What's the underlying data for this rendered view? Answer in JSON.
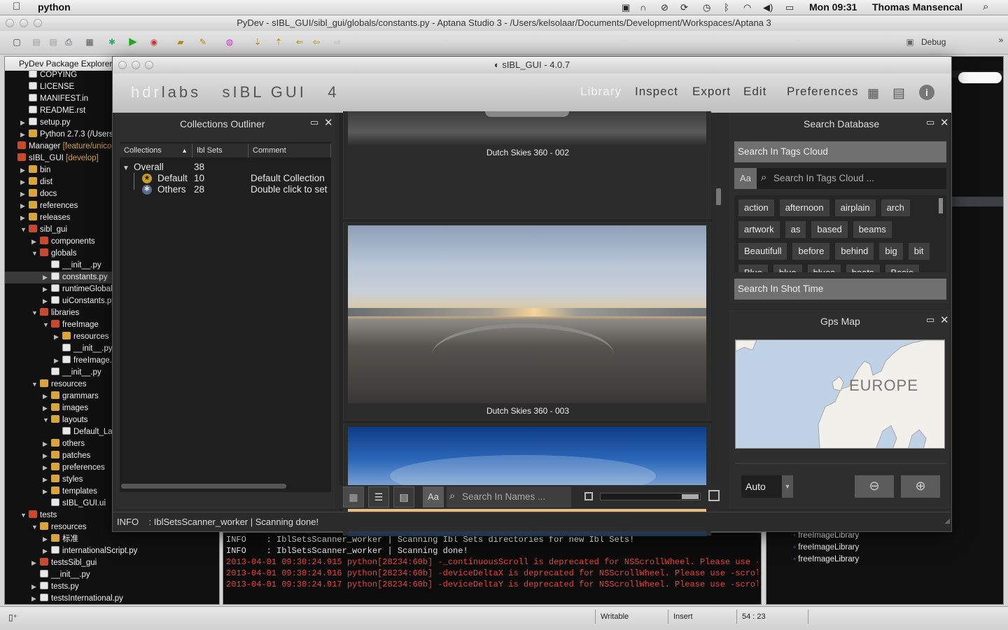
{
  "menubar": {
    "apple": "",
    "app_name": "python",
    "clock": "Mon 09:31",
    "user": "Thomas Mansencal"
  },
  "aptana": {
    "title": "PyDev - sIBL_GUI/sibl_gui/globals/constants.py - Aptana Studio 3 - /Users/kelsolaar/Documents/Development/Workspaces/Aptana 3",
    "debug_label": "Debug"
  },
  "package_explorer": {
    "tab_label": "PyDev Package Explorer",
    "items": [
      {
        "label": "COPYING",
        "indent": 1,
        "arrow": "",
        "icon": "file"
      },
      {
        "label": "LICENSE",
        "indent": 1,
        "arrow": "",
        "icon": "file"
      },
      {
        "label": "MANIFEST.in",
        "indent": 1,
        "arrow": "",
        "icon": "file"
      },
      {
        "label": "README.rst",
        "indent": 1,
        "arrow": "",
        "icon": "file"
      },
      {
        "label": "setup.py",
        "indent": 1,
        "arrow": "▶",
        "icon": "py"
      },
      {
        "label": "Python 2.7.3  (/Users",
        "indent": 1,
        "arrow": "▶",
        "icon": "folder"
      },
      {
        "label": "Manager",
        "deco": " [feature/unicod",
        "indent": 0,
        "arrow": "",
        "icon": "pkg"
      },
      {
        "label": "sIBL_GUI",
        "deco": " [develop]",
        "indent": 0,
        "arrow": "",
        "icon": "pkg"
      },
      {
        "label": "bin",
        "indent": 1,
        "arrow": "▶",
        "icon": "folder"
      },
      {
        "label": "dist",
        "indent": 1,
        "arrow": "▶",
        "icon": "folder"
      },
      {
        "label": "docs",
        "indent": 1,
        "arrow": "▶",
        "icon": "folder"
      },
      {
        "label": "references",
        "indent": 1,
        "arrow": "▶",
        "icon": "folder"
      },
      {
        "label": "releases",
        "indent": 1,
        "arrow": "▶",
        "icon": "folder"
      },
      {
        "label": "sibl_gui",
        "indent": 1,
        "arrow": "▼",
        "icon": "pkg"
      },
      {
        "label": "components",
        "indent": 2,
        "arrow": "▶",
        "icon": "pkg"
      },
      {
        "label": "globals",
        "indent": 2,
        "arrow": "▼",
        "icon": "pkg"
      },
      {
        "label": "__init__.py",
        "indent": 3,
        "arrow": "",
        "icon": "py"
      },
      {
        "label": "constants.py",
        "indent": 3,
        "arrow": "▶",
        "icon": "py",
        "selected": true
      },
      {
        "label": "runtimeGlobals.",
        "indent": 3,
        "arrow": "▶",
        "icon": "py"
      },
      {
        "label": "uiConstants.py",
        "indent": 3,
        "arrow": "▶",
        "icon": "py"
      },
      {
        "label": "libraries",
        "indent": 2,
        "arrow": "▼",
        "icon": "pkg"
      },
      {
        "label": "freeImage",
        "indent": 3,
        "arrow": "▼",
        "icon": "pkg"
      },
      {
        "label": "resources",
        "indent": 4,
        "arrow": "▶",
        "icon": "folder"
      },
      {
        "label": "__init__.py",
        "indent": 4,
        "arrow": "",
        "icon": "py"
      },
      {
        "label": "freeImage.py",
        "indent": 4,
        "arrow": "▶",
        "icon": "py"
      },
      {
        "label": "__init__.py",
        "indent": 3,
        "arrow": "",
        "icon": "py"
      },
      {
        "label": "resources",
        "indent": 2,
        "arrow": "▼",
        "icon": "folder"
      },
      {
        "label": "grammars",
        "indent": 3,
        "arrow": "▶",
        "icon": "folder"
      },
      {
        "label": "images",
        "indent": 3,
        "arrow": "▶",
        "icon": "folder"
      },
      {
        "label": "layouts",
        "indent": 3,
        "arrow": "▼",
        "icon": "folder"
      },
      {
        "label": "Default_Layo",
        "indent": 4,
        "arrow": "",
        "icon": "file"
      },
      {
        "label": "others",
        "indent": 3,
        "arrow": "▶",
        "icon": "folder"
      },
      {
        "label": "patches",
        "indent": 3,
        "arrow": "▶",
        "icon": "folder"
      },
      {
        "label": "preferences",
        "indent": 3,
        "arrow": "▶",
        "icon": "folder"
      },
      {
        "label": "styles",
        "indent": 3,
        "arrow": "▶",
        "icon": "folder"
      },
      {
        "label": "templates",
        "indent": 3,
        "arrow": "▶",
        "icon": "folder"
      },
      {
        "label": "sIBL_GUI.ui",
        "indent": 3,
        "arrow": "",
        "icon": "file"
      },
      {
        "label": "tests",
        "indent": 1,
        "arrow": "▼",
        "icon": "pkg"
      },
      {
        "label": "resources",
        "indent": 2,
        "arrow": "▼",
        "icon": "folder"
      },
      {
        "label": "标准",
        "indent": 3,
        "arrow": "▶",
        "icon": "folder"
      },
      {
        "label": "internationalScript.py",
        "indent": 3,
        "arrow": "▶",
        "icon": "py"
      },
      {
        "label": "testsSibl_gui",
        "indent": 2,
        "arrow": "▶",
        "icon": "pkg"
      },
      {
        "label": "__init__.py",
        "indent": 2,
        "arrow": "",
        "icon": "py"
      },
      {
        "label": "tests.py",
        "indent": 2,
        "arrow": "▶",
        "icon": "py"
      },
      {
        "label": "testsInternational.py",
        "indent": 2,
        "arrow": "▶",
        "icon": "py"
      }
    ]
  },
  "outline_items": [
    "freeImageLibrary",
    "freeImageLibrary",
    "freeImageLibrary"
  ],
  "console": {
    "lines": [
      {
        "text": "INFO    : IblSetsScanner_worker | Scanning Ibl Sets directories for new Ibl Sets!",
        "color": "#e6e6e6"
      },
      {
        "text": "INFO    : IblSetsScanner_worker | Scanning done!",
        "color": "#e6e6e6"
      },
      {
        "text": "2013-04-01 09:30:24.915 python[28234:60b] -_continuousScroll is deprecated for NSScrollWheel. Please use -has",
        "color": "#e8413a"
      },
      {
        "text": "2013-04-01 09:30:24.916 python[28234:60b] -deviceDeltaX is deprecated for NSScrollWheel. Please use -scrollin",
        "color": "#e8413a"
      },
      {
        "text": "2013-04-01 09:30:24.917 python[28234:60b] -deviceDeltaY is deprecated for NSScrollWheel. Please use -scrollin",
        "color": "#e8413a"
      }
    ]
  },
  "statusbar": {
    "writable": "Writable",
    "insert": "Insert",
    "position": "54 : 23"
  },
  "sibl": {
    "title": "sIBL_GUI - 4.0.7",
    "logo_hdr": "hdr",
    "logo_rest": "labs   sIBL GUI   4",
    "nav": [
      "Library",
      "Inspect",
      "Export",
      "Edit",
      "Preferences"
    ],
    "active_nav": "Library",
    "collections": {
      "title": "Collections Outliner",
      "columns": [
        "Collections",
        "Ibl Sets",
        "Comment"
      ],
      "rows": [
        {
          "name": "Overall",
          "count": "38",
          "comment": ""
        },
        {
          "name": "Default",
          "count": "10",
          "comment": "Default Collection"
        },
        {
          "name": "Others",
          "count": "28",
          "comment": "Double click to set"
        }
      ]
    },
    "thumbnails": [
      {
        "caption": "Dutch Skies 360 - 002"
      },
      {
        "caption": "Dutch Skies 360 - 003"
      },
      {
        "caption": ""
      }
    ],
    "names_search_placeholder": "Search In Names ...",
    "search_db": {
      "title": "Search Database",
      "tags_cloud_header": "Search In Tags Cloud",
      "case_button": "Aa",
      "tags_placeholder": "Search In Tags Cloud ...",
      "tags": [
        "action",
        "afternoon",
        "airplain",
        "arch",
        "artwork",
        "as",
        "based",
        "beams",
        "Beautifull",
        "before",
        "behind",
        "big",
        "bit",
        "Blue",
        "blue",
        "blues",
        "boats",
        "Bosie"
      ],
      "shot_time_header": "Search In Shot Time"
    },
    "gps": {
      "title": "Gps Map",
      "map_label": "EUROPE",
      "map_type": "Auto"
    },
    "status_message": "INFO    : IblSetsScanner_worker | Scanning done!"
  }
}
